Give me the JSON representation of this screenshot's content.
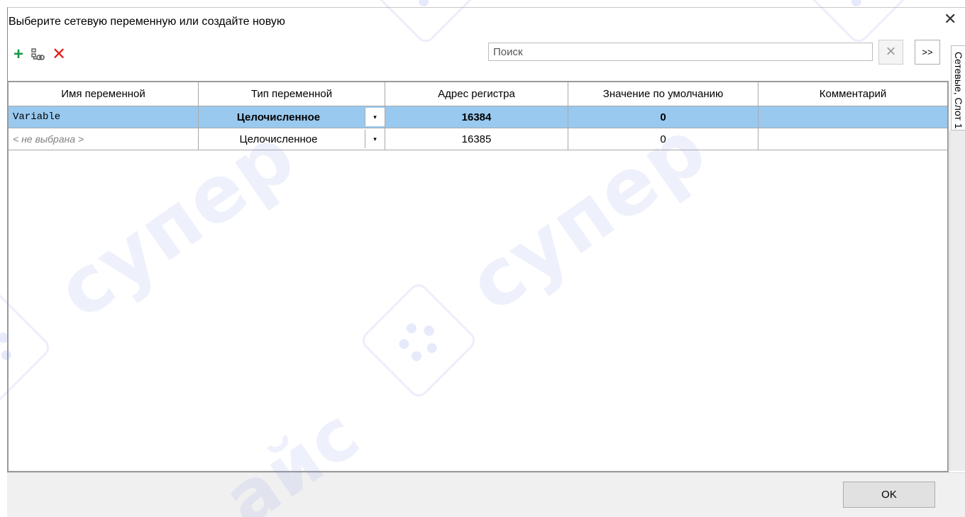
{
  "dialog": {
    "title": "Выберите сетевую переменную или создайте новую",
    "close_glyph": "✕"
  },
  "toolbar": {
    "add_icon": "plus-icon",
    "add_glyph": "+",
    "link_icon": "link-variable-icon",
    "delete_icon": "delete-icon",
    "delete_glyph": "✕",
    "add_color": "#1a9a4a",
    "delete_color": "#e02020"
  },
  "search": {
    "placeholder": "Поиск",
    "value": "",
    "clear_glyph": "×",
    "more_label": ">>"
  },
  "side_tab": {
    "label": "Сетевые, Слот 1"
  },
  "table": {
    "columns": [
      "Имя переменной",
      "Тип переменной",
      "Адрес регистра",
      "Значение по умолчанию",
      "Комментарий"
    ],
    "rows": [
      {
        "name": "Variable",
        "type": "Целочисленное",
        "address": "16384",
        "default": "0",
        "comment": "",
        "selected": true
      },
      {
        "name": "< не выбрана >",
        "type": "Целочисленное",
        "address": "16385",
        "default": "0",
        "comment": "",
        "selected": false
      }
    ],
    "dropdown_glyph": "▾",
    "selected_row_color": "#99c9ef"
  },
  "footer": {
    "ok_label": "OK"
  },
  "watermark": {
    "text": "сyпер",
    "text2": "айс"
  }
}
